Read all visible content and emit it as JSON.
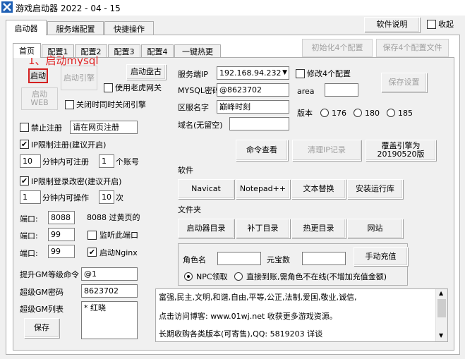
{
  "window": {
    "title": "游戏启动器 2022 - 04 - 15"
  },
  "top": {
    "help_button": "软件说明",
    "collapse_label": "收起"
  },
  "outer_tabs": [
    "启动器",
    "服务端配置",
    "快捷操作"
  ],
  "inner_tabs": [
    "首页",
    "配置1",
    "配置2",
    "配置3",
    "配置4",
    "一键热更"
  ],
  "config_buttons": {
    "init": "初始化4个配置",
    "save": "保存4个配置文件"
  },
  "annotation": "1、启动mysql",
  "launch": {
    "start": "启动",
    "start_engine": "启动引擎",
    "start_web": "启动WEB",
    "start_disk": "启动盘古",
    "use_tiger": "使用老虎网关",
    "close_engine": "关闭时同时关闭引擎"
  },
  "register": {
    "disable_label": "禁止注册",
    "disable_value": "请在网页注册",
    "ip_limit_label": "IP限制注册(建议开启)",
    "minutes_value": "10",
    "minutes_label": "分钟内可注册",
    "accounts_value": "1",
    "accounts_label": "个账号",
    "ip_login_label": "IP限制登录改密(建议开启)",
    "login_minutes_value": "1",
    "login_minutes_label": "分钟内可操作",
    "times_value": "10",
    "times_label": "次"
  },
  "ports": {
    "port_label": "端口:",
    "p1_value": "8088",
    "p1_note": "8088 过黄页的",
    "p2_value": "99",
    "p2_note": "监听此端口",
    "p3_value": "99",
    "p3_note": "启动Nginx"
  },
  "gm": {
    "level_label": "提升GM等级命令",
    "level_value": "@1",
    "pwd_label": "超级GM密码",
    "pwd_value": "8623702",
    "list_label": "超级GM列表",
    "list_value": "* 红晓",
    "save": "保存"
  },
  "server": {
    "ip_label": "服务端IP",
    "ip_value": "192.168.94.232",
    "modify_label": "修改4个配置",
    "mysql_label": "MYSQL密码",
    "mysql_value": "@8623702",
    "area_label": "area",
    "zone_label": "区服名字",
    "zone_value": "巅峰时刻",
    "domain_label": "域名(无留空)",
    "version_label": "版本",
    "versions": [
      "176",
      "180",
      "185"
    ],
    "save_settings": "保存设置"
  },
  "commands": {
    "view": "命令查看",
    "clear_ip": "清理IP记录",
    "cover_engine": "覆盖引擎为20190520版"
  },
  "software": {
    "heading": "软件",
    "items": [
      "Navicat",
      "Notepad++",
      "文本替换",
      "安装运行库"
    ]
  },
  "folders": {
    "heading": "文件夹",
    "items": [
      "启动器目录",
      "补丁目录",
      "热更目录",
      "网站"
    ]
  },
  "recharge": {
    "role_label": "角色名",
    "gold_label": "元宝数",
    "manual_button": "手动充值",
    "npc_label": "NPC领取",
    "direct_label": "直接到账,需角色不在线(不增加充值金额)"
  },
  "log": {
    "line1": "富强,民主,文明,和谐,自由,平等,公正,法制,爱国,敬业,诚信,",
    "line2": "点击访问博客: www.01wj.net    收获更多游戏资源。",
    "line3": "长期收购各类版本(可寄售),QQ: 5819203 详谈"
  },
  "colors": {
    "annotation": "#e02020",
    "highlight_border": "#d42020"
  }
}
